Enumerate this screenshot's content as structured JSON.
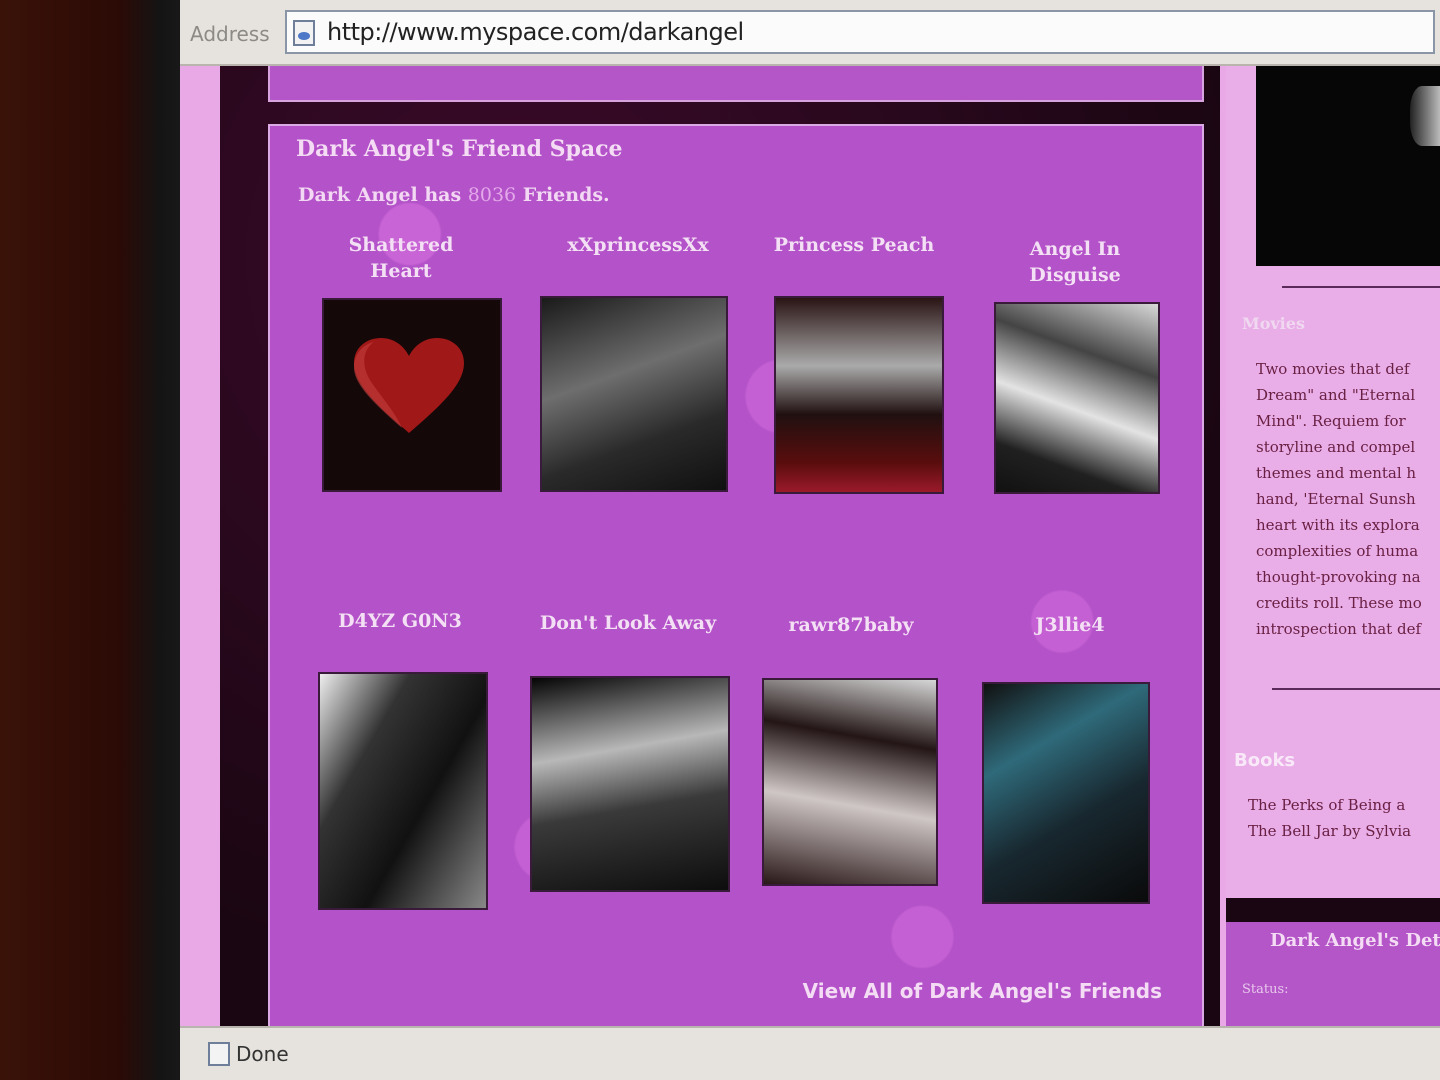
{
  "browser": {
    "address_label": "Address",
    "url": "http://www.myspace.com/darkangel",
    "status": "Done"
  },
  "friend_space": {
    "title": "Dark Angel's Friend Space",
    "count_prefix": "Dark Angel has",
    "count": "8036",
    "count_suffix": "Friends.",
    "friends": [
      {
        "name": "Shattered Heart"
      },
      {
        "name": "xXprincessXx"
      },
      {
        "name": "Princess Peach"
      },
      {
        "name": "Angel In Disguise"
      },
      {
        "name": "D4YZ G0N3"
      },
      {
        "name": "Don't Look Away"
      },
      {
        "name": "rawr87baby"
      },
      {
        "name": "J3llie4"
      }
    ],
    "view_all": "View All of Dark Angel's Friends"
  },
  "sidebar": {
    "movies_heading": "Movies",
    "movies_text": [
      "Two movies that def",
      "Dream\" and \"Eternal",
      "Mind\". Requiem for",
      "storyline and compel",
      "themes and mental h",
      "hand, 'Eternal Sunsh",
      "heart with its explora",
      "complexities of huma",
      "thought-provoking na",
      "credits roll. These mo",
      "introspection that def"
    ],
    "books_heading": "Books",
    "books_text": [
      "The Perks of Being a",
      "The Bell Jar by Sylvia"
    ],
    "details_title": "Dark Angel's Det",
    "status_label": "Status:"
  },
  "colors": {
    "panel_purple": "#b453c9",
    "accent_pink": "#e9aee7",
    "dark_bg": "#1a0612"
  }
}
